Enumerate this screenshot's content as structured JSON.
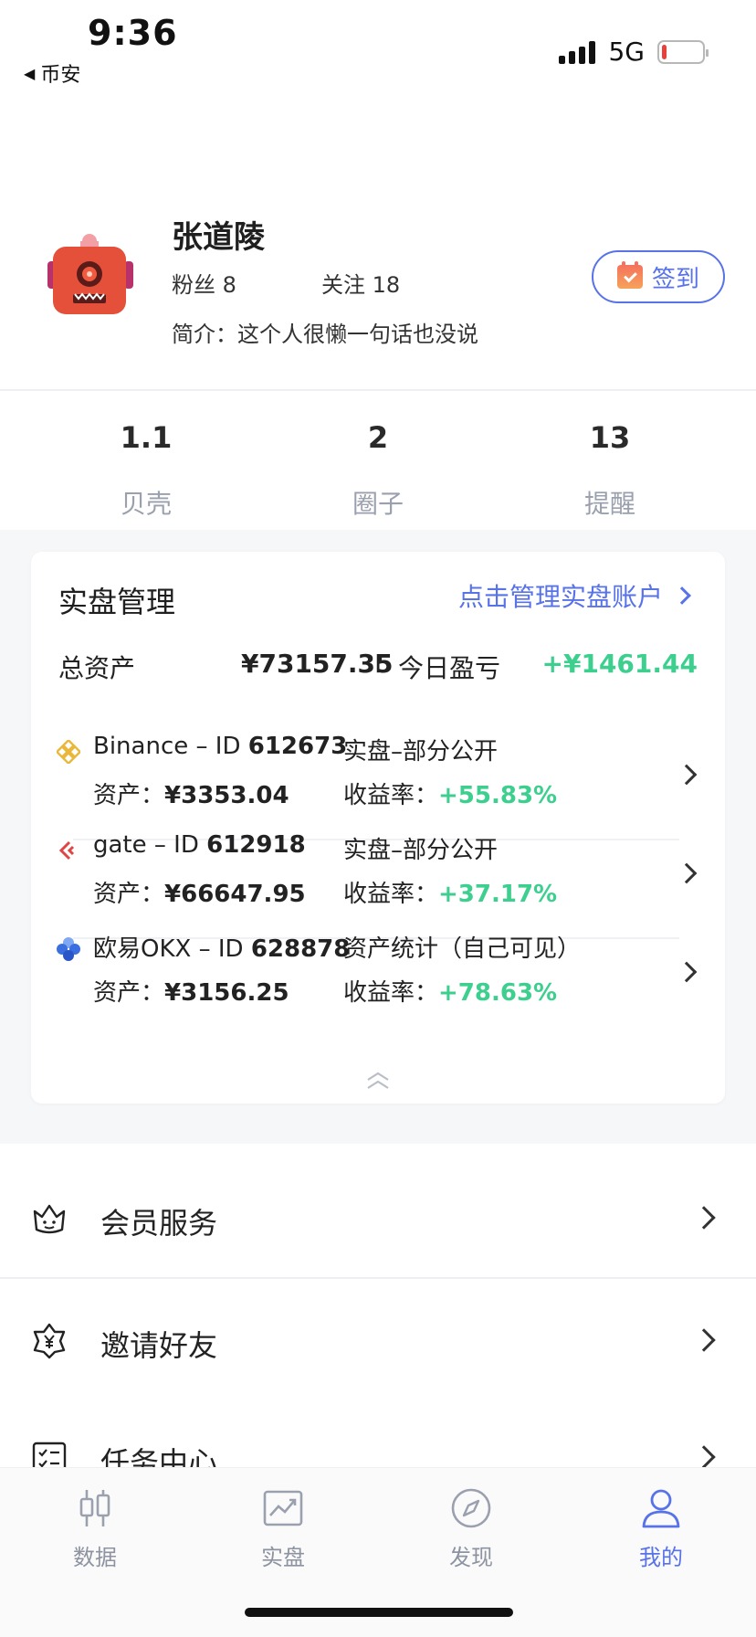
{
  "status_bar": {
    "time": "9:36",
    "back_app": "币安",
    "network": "5G",
    "battery_level": 0.12
  },
  "profile": {
    "username": "张道陵",
    "followers_label": "粉丝",
    "followers_count": "8",
    "following_label": "关注",
    "following_count": "18",
    "bio_label": "简介：",
    "bio_text": "这个人很懒一句话也没说",
    "checkin_label": "签到"
  },
  "counters": [
    {
      "value": "1.1",
      "label": "贝壳"
    },
    {
      "value": "2",
      "label": "圈子"
    },
    {
      "value": "13",
      "label": "提醒"
    }
  ],
  "asset_card": {
    "title": "实盘管理",
    "manage_link": "点击管理实盘账户",
    "total_label": "总资产",
    "total_value": "¥73157.35",
    "separator": "I",
    "today_pnl_label": "今日盈亏",
    "today_pnl_value": "+¥1461.44",
    "accounts": [
      {
        "exchange": "Binance",
        "id_prefix": " – ID ",
        "id": "612673",
        "asset_label": "资产：",
        "asset": "¥3353.04",
        "type": "实盘–部分公开",
        "yield_label": "收益率：",
        "yield": "+55.83%",
        "icon": "binance-icon"
      },
      {
        "exchange": "gate",
        "id_prefix": " – ID ",
        "id": "612918",
        "asset_label": "资产：",
        "asset": "¥66647.95",
        "type": "实盘–部分公开",
        "yield_label": "收益率：",
        "yield": "+37.17%",
        "icon": "gate-icon"
      },
      {
        "exchange": "欧易OKX",
        "id_prefix": " – ID ",
        "id": "628878",
        "asset_label": "资产：",
        "asset": "¥3156.25",
        "type": "资产统计（自己可见）",
        "yield_label": "收益率：",
        "yield": "+78.63%",
        "icon": "okx-icon"
      }
    ]
  },
  "menu": [
    {
      "label": "会员服务",
      "icon": "crown-icon"
    },
    {
      "label": "邀请好友",
      "icon": "yuan-badge-icon"
    },
    {
      "label": "任务中心",
      "icon": "checklist-icon"
    }
  ],
  "tabbar": [
    {
      "label": "数据",
      "icon": "candlestick-icon",
      "active": false
    },
    {
      "label": "实盘",
      "icon": "chart-board-icon",
      "active": false
    },
    {
      "label": "发现",
      "icon": "compass-icon",
      "active": false
    },
    {
      "label": "我的",
      "icon": "user-icon",
      "active": true
    }
  ],
  "colors": {
    "accent": "#5872e8",
    "profit": "#3ccf8e",
    "muted": "#9aa0ad"
  }
}
